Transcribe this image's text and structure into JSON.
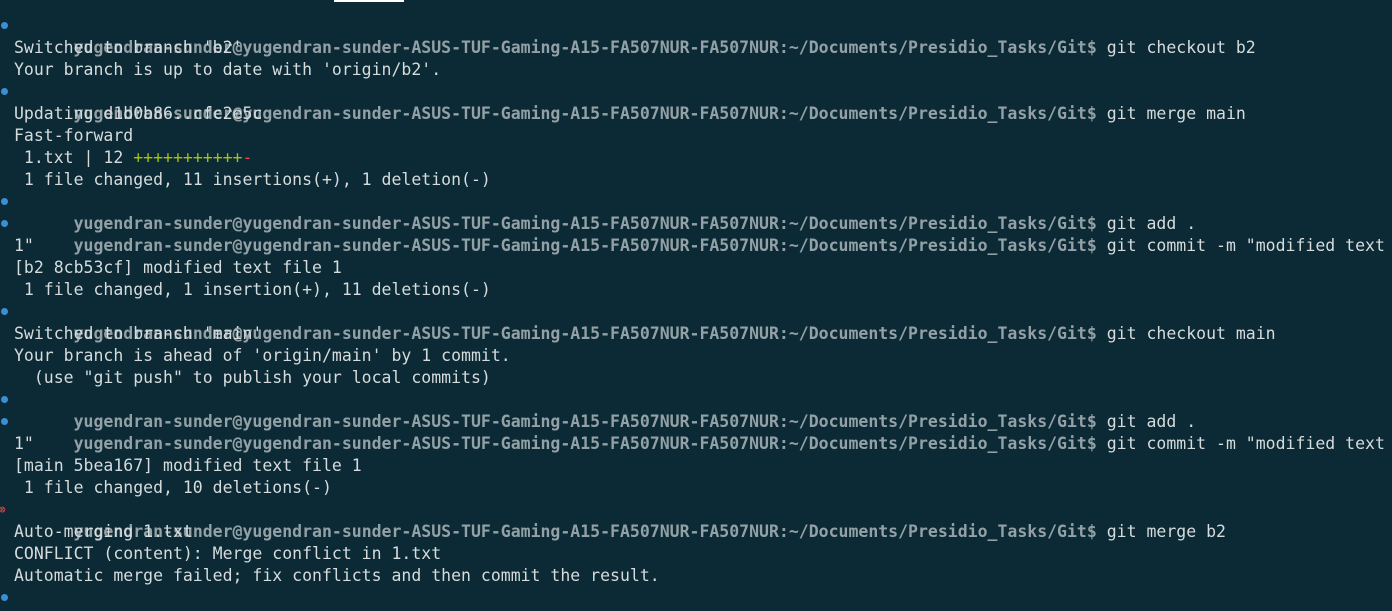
{
  "terminal": {
    "prompt": "yugendran-sunder@yugendran-sunder-ASUS-TUF-Gaming-A15-FA507NUR-FA507NUR:~/Documents/Presidio_Tasks/Git$",
    "lines": {
      "l01": "git checkout b2",
      "l02": "Switched to branch 'b2'",
      "l03": "Your branch is up to date with 'origin/b2'.",
      "l04": "git merge main",
      "l05": "Updating d1b0b86..cfc2e5c",
      "l06": "Fast-forward",
      "l07_prefix": " 1.txt | 12 ",
      "l07_plus": "+++++++++++",
      "l07_minus": "-",
      "l08": " 1 file changed, 11 insertions(+), 1 deletion(-)",
      "l09": "git add .",
      "l10": "git commit -m \"modified text file",
      "l11": "1\"",
      "l12": "[b2 8cb53cf] modified text file 1",
      "l13": " 1 file changed, 1 insertion(+), 11 deletions(-)",
      "l14": "git checkout main",
      "l15": "Switched to branch 'main'",
      "l16": "Your branch is ahead of 'origin/main' by 1 commit.",
      "l17": "  (use \"git push\" to publish your local commits)",
      "l18": "git add .",
      "l19": "git commit -m \"modified text file",
      "l20": "1\"",
      "l21": "[main 5bea167] modified text file 1",
      "l22": " 1 file changed, 10 deletions(-)",
      "l23": "git merge b2",
      "l24": "Auto-merging 1.txt",
      "l25": "CONFLICT (content): Merge conflict in 1.txt",
      "l26": "Automatic merge failed; fix conflicts and then commit the result."
    }
  },
  "colors": {
    "background": "#0b2a35",
    "prompt": "#93a1a6",
    "text": "#d6dbdc",
    "success_marker": "#3a8fd6",
    "error_marker": "#e34a4a",
    "diff_plus": "#a6c200",
    "diff_minus": "#e34a4a"
  },
  "icons": {
    "success_marker": "circle-dot-icon",
    "error_marker": "circled-x-icon"
  }
}
